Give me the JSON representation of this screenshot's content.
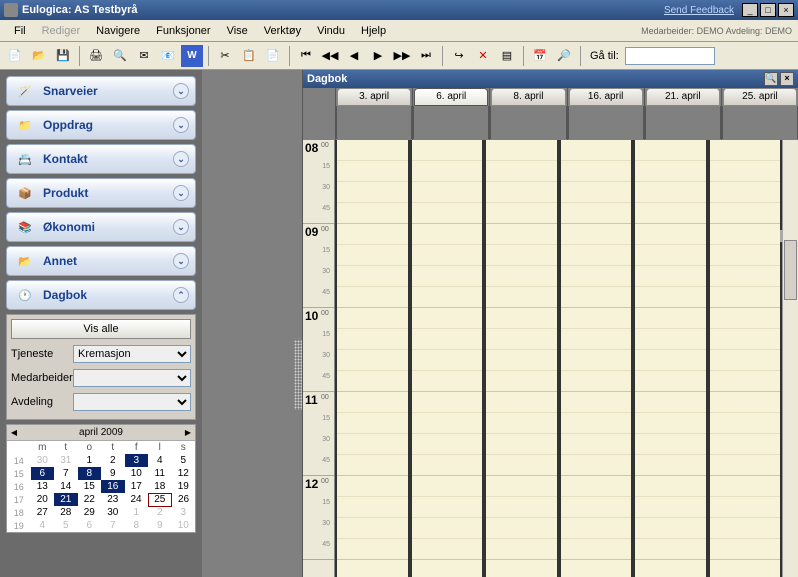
{
  "titlebar": {
    "title": "Eulogica: AS Testbyrå",
    "feedback": "Send Feedback"
  },
  "menu": {
    "fil": "Fil",
    "rediger": "Rediger",
    "navigere": "Navigere",
    "funksjoner": "Funksjoner",
    "vise": "Vise",
    "verktoy": "Verktøy",
    "vindu": "Vindu",
    "hjelp": "Hjelp"
  },
  "status": "Medarbeider: DEMO  Avdeling: DEMO",
  "toolbar": {
    "goto": "Gå til:"
  },
  "nav": {
    "snarveier": "Snarveier",
    "oppdrag": "Oppdrag",
    "kontakt": "Kontakt",
    "produkt": "Produkt",
    "okonomi": "Økonomi",
    "annet": "Annet",
    "dagbok": "Dagbok"
  },
  "filter": {
    "visalle": "Vis alle",
    "tjeneste": "Tjeneste",
    "tjeneste_val": "Kremasjon",
    "medarbeider": "Medarbeider",
    "avdeling": "Avdeling"
  },
  "minical": {
    "month": "april 2009",
    "days": [
      "m",
      "t",
      "o",
      "t",
      "f",
      "l",
      "s"
    ],
    "weeks": [
      {
        "w": "14",
        "d": [
          {
            "v": "30",
            "c": "dim"
          },
          {
            "v": "31",
            "c": "dim"
          },
          {
            "v": "1"
          },
          {
            "v": "2"
          },
          {
            "v": "3",
            "c": "sel"
          },
          {
            "v": "4"
          },
          {
            "v": "5"
          }
        ]
      },
      {
        "w": "15",
        "d": [
          {
            "v": "6",
            "c": "sel"
          },
          {
            "v": "7"
          },
          {
            "v": "8",
            "c": "sel"
          },
          {
            "v": "9"
          },
          {
            "v": "10"
          },
          {
            "v": "11"
          },
          {
            "v": "12"
          }
        ]
      },
      {
        "w": "16",
        "d": [
          {
            "v": "13"
          },
          {
            "v": "14"
          },
          {
            "v": "15"
          },
          {
            "v": "16",
            "c": "sel"
          },
          {
            "v": "17"
          },
          {
            "v": "18"
          },
          {
            "v": "19"
          }
        ]
      },
      {
        "w": "17",
        "d": [
          {
            "v": "20"
          },
          {
            "v": "21",
            "c": "sel"
          },
          {
            "v": "22"
          },
          {
            "v": "23"
          },
          {
            "v": "24"
          },
          {
            "v": "25",
            "c": "box"
          },
          {
            "v": "26"
          }
        ]
      },
      {
        "w": "18",
        "d": [
          {
            "v": "27"
          },
          {
            "v": "28"
          },
          {
            "v": "29"
          },
          {
            "v": "30"
          },
          {
            "v": "1",
            "c": "dim"
          },
          {
            "v": "2",
            "c": "dim"
          },
          {
            "v": "3",
            "c": "dim"
          }
        ]
      },
      {
        "w": "19",
        "d": [
          {
            "v": "4",
            "c": "dim"
          },
          {
            "v": "5",
            "c": "dim"
          },
          {
            "v": "6",
            "c": "dim"
          },
          {
            "v": "7",
            "c": "dim"
          },
          {
            "v": "8",
            "c": "dim"
          },
          {
            "v": "9",
            "c": "dim"
          },
          {
            "v": "10",
            "c": "dim"
          }
        ]
      }
    ]
  },
  "dagbok": {
    "title": "Dagbok",
    "dates": [
      "3. april",
      "6. april",
      "8. april",
      "16. april",
      "21. april",
      "25. april"
    ],
    "active_date": 1,
    "hours": [
      "08",
      "09",
      "10",
      "11",
      "12"
    ],
    "mins": [
      "15",
      "30",
      "45"
    ]
  }
}
